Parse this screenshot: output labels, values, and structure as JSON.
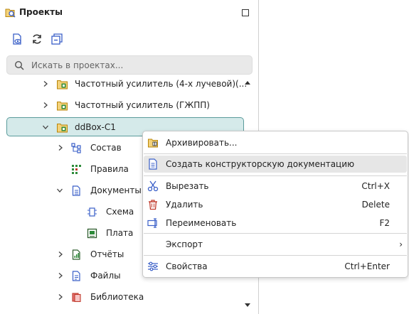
{
  "panel": {
    "title": "Проекты",
    "search_placeholder": "Искать в проектах..."
  },
  "tree": {
    "items": [
      {
        "label": "Частотный усилитель (4-х лучевой)(...",
        "icon": "project-icon"
      },
      {
        "label": "Частотный усилитель (ГЖПП)",
        "icon": "project-icon"
      },
      {
        "label": "ddBox-C1",
        "icon": "project-icon"
      },
      {
        "label": "Состав",
        "icon": "structure-icon"
      },
      {
        "label": "Правила",
        "icon": "rules-icon"
      },
      {
        "label": "Документы",
        "icon": "documents-icon"
      },
      {
        "label": "Схема",
        "icon": "schematic-icon"
      },
      {
        "label": "Плата",
        "icon": "board-icon"
      },
      {
        "label": "Отчёты",
        "icon": "reports-icon"
      },
      {
        "label": "Файлы",
        "icon": "files-icon"
      },
      {
        "label": "Библиотека",
        "icon": "library-icon"
      }
    ]
  },
  "context_menu": {
    "items": [
      {
        "label": "Архивировать...",
        "shortcut": "",
        "icon": "archive-icon"
      },
      {
        "label": "Создать конструкторскую документацию",
        "shortcut": "",
        "icon": "create-docs-icon"
      },
      {
        "label": "Вырезать",
        "shortcut": "Ctrl+X",
        "icon": "cut-icon"
      },
      {
        "label": "Удалить",
        "shortcut": "Delete",
        "icon": "delete-icon"
      },
      {
        "label": "Переименовать",
        "shortcut": "F2",
        "icon": "rename-icon"
      },
      {
        "label": "Экспорт",
        "shortcut": "",
        "icon": ""
      },
      {
        "label": "Свойства",
        "shortcut": "Ctrl+Enter",
        "icon": "properties-icon"
      }
    ]
  },
  "colors": {
    "selected_bg": "#d5eaea",
    "selected_border": "#5a9b9b",
    "icon_blue": "#3a5fc8",
    "icon_green": "#2e8b3a",
    "icon_red": "#c0392b"
  }
}
